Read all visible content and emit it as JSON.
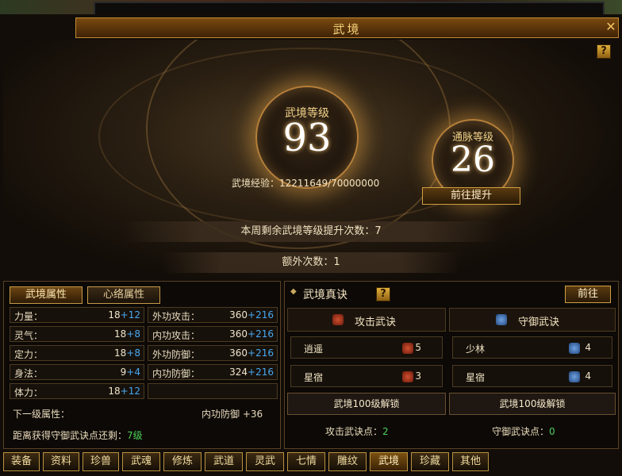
{
  "window": {
    "title": "武境"
  },
  "hero": {
    "level_label": "武境等级",
    "level_value": "93",
    "meridian_label": "通脉等级",
    "meridian_value": "26",
    "exp_label": "武境经验：",
    "exp_value": "12211649/70000000",
    "promote_button": "前往提升",
    "weekly_text": "本周剩余武境等级提升次数：7",
    "extra_text": "额外次数：1"
  },
  "left_panel": {
    "tabs": [
      "武境属性",
      "心络属性"
    ],
    "stats_left": [
      {
        "name": "力量：",
        "base": "18",
        "bonus": "+12"
      },
      {
        "name": "灵气：",
        "base": "18",
        "bonus": "+8"
      },
      {
        "name": "定力：",
        "base": "18",
        "bonus": "+8"
      },
      {
        "name": "身法：",
        "base": "9",
        "bonus": "+4"
      },
      {
        "name": "体力：",
        "base": "18",
        "bonus": "+12"
      }
    ],
    "stats_right": [
      {
        "name": "外功攻击：",
        "base": "360",
        "bonus": "+216"
      },
      {
        "name": "内功攻击：",
        "base": "360",
        "bonus": "+216"
      },
      {
        "name": "外功防御：",
        "base": "360",
        "bonus": "+216"
      },
      {
        "name": "内功防御：",
        "base": "324",
        "bonus": "+216"
      }
    ],
    "next_level_label": "下一级属性：",
    "next_level_value": "内功防御 +36",
    "distance_label": "距离获得守御武诀点还剩：",
    "distance_value": "7级"
  },
  "right_panel": {
    "title": "武境真诀",
    "go_button": "前往",
    "attack": {
      "header": "攻击武诀",
      "items": [
        {
          "name": "逍遥",
          "value": "5"
        },
        {
          "name": "星宿",
          "value": "3"
        }
      ],
      "unlock": "武境100级解锁",
      "points_label": "攻击武诀点：",
      "points_value": "2"
    },
    "defense": {
      "header": "守御武诀",
      "items": [
        {
          "name": "少林",
          "value": "4"
        },
        {
          "name": "星宿",
          "value": "4"
        }
      ],
      "unlock": "武境100级解锁",
      "points_label": "守御武诀点：",
      "points_value": "0"
    }
  },
  "bottom_tabs": [
    "装备",
    "资料",
    "珍兽",
    "武魂",
    "修炼",
    "武道",
    "灵武",
    "七情",
    "雕纹",
    "武境",
    "珍藏",
    "其他"
  ],
  "help_glyph": "?",
  "close_glyph": "✕",
  "colors": {
    "accent": "#d0a040",
    "bonus": "#48a8f0",
    "points": "#4cd05a"
  }
}
